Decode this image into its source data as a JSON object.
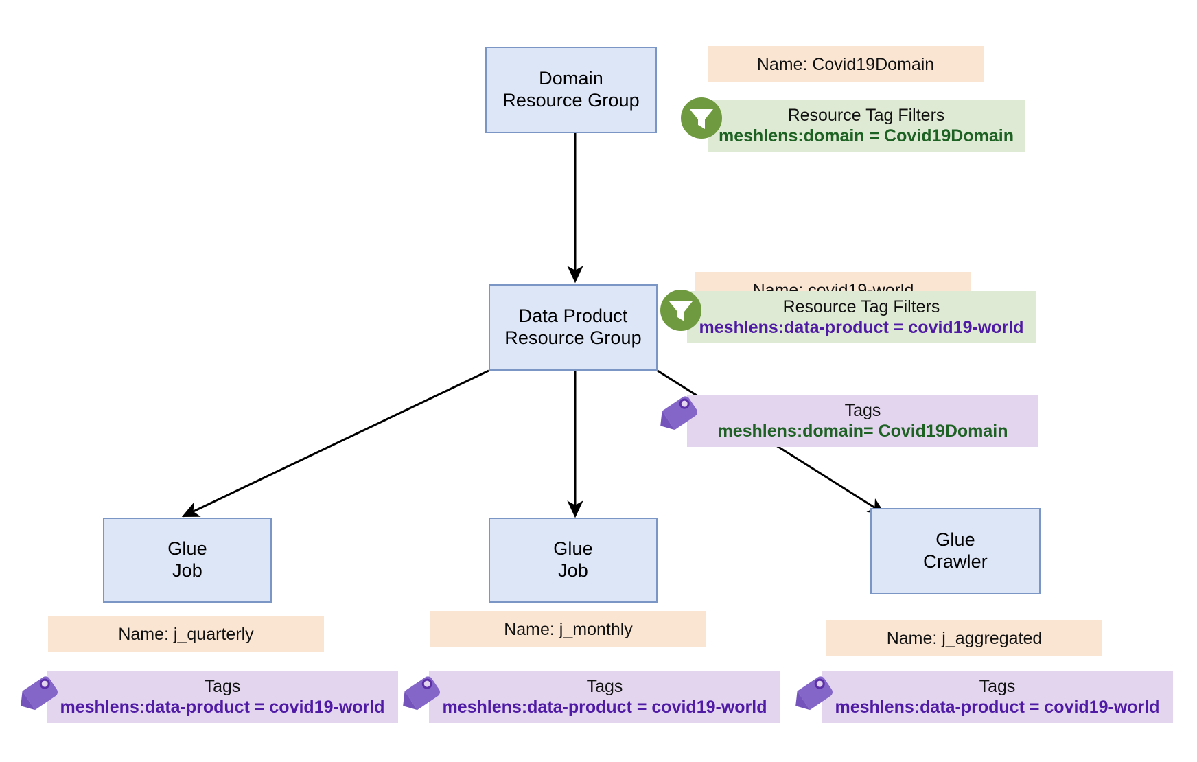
{
  "diagram": {
    "type": "hierarchy",
    "title": "",
    "colors": {
      "node_fill": "#dce6f7",
      "node_border": "#7b96c4",
      "name_chip": "#fae5d3",
      "filter_chip": "#dfead4",
      "tag_chip": "#e3d5ee",
      "green_text": "#1d6123",
      "purple_text": "#4f1ba5",
      "filter_icon": "#6f9a3f",
      "tag_icon": "#8465c8"
    }
  },
  "nodes": [
    {
      "id": "domain",
      "line1": "Domain",
      "line2": "Resource Group"
    },
    {
      "id": "data_product",
      "line1": "Data Product",
      "line2": "Resource Group"
    },
    {
      "id": "glue_job_q",
      "line1": "Glue",
      "line2": "Job"
    },
    {
      "id": "glue_job_m",
      "line1": "Glue",
      "line2": "Job"
    },
    {
      "id": "glue_crawler",
      "line1": "Glue",
      "line2": "Crawler"
    }
  ],
  "annotations": {
    "domain_name": {
      "text": "Name: Covid19Domain"
    },
    "domain_filter": {
      "title": "Resource Tag Filters",
      "kv": "meshlens:domain = Covid19Domain"
    },
    "dp_name": {
      "text": "Name: covid19-world"
    },
    "dp_filter": {
      "title": "Resource Tag Filters",
      "kv": "meshlens:data-product = covid19-world"
    },
    "dp_tags": {
      "title": "Tags",
      "kv": "meshlens:domain= Covid19Domain"
    },
    "jq_name": {
      "text": "Name: j_quarterly"
    },
    "jq_tags": {
      "title": "Tags",
      "kv": "meshlens:data-product = covid19-world"
    },
    "jm_name": {
      "text": "Name: j_monthly"
    },
    "jm_tags": {
      "title": "Tags",
      "kv": "meshlens:data-product = covid19-world"
    },
    "ja_name": {
      "text": "Name: j_aggregated"
    },
    "ja_tags": {
      "title": "Tags",
      "kv": "meshlens:data-product = covid19-world"
    }
  },
  "icons": {
    "filter": "filter-funnel-icon",
    "tag": "tag-label-icon"
  }
}
